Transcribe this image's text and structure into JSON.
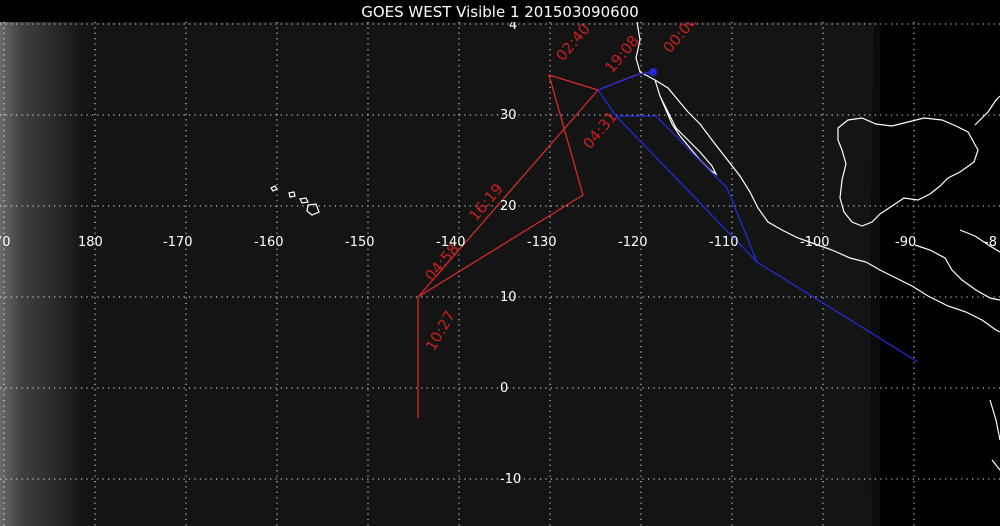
{
  "title": "GOES WEST Visible 1 201503090600",
  "map": {
    "longitude_labels": [
      "70",
      "180",
      "-170",
      "-160",
      "-150",
      "-140",
      "-130",
      "-120",
      "-110",
      "-100",
      "-90",
      "-8"
    ],
    "latitude_labels": [
      "30",
      "20",
      "10",
      "0",
      "-10"
    ],
    "top_partial_label": "4"
  },
  "tracks": {
    "red": {
      "color": "#d42a2a",
      "labels": [
        "02:40",
        "19:08",
        "00:00",
        "16:19",
        "04:58",
        "10:27",
        "04:31"
      ]
    },
    "blue": {
      "color": "#1f2bd6"
    }
  },
  "colors": {
    "background": "#000000",
    "ocean_image": "#111111",
    "coastline": "#ffffff"
  }
}
